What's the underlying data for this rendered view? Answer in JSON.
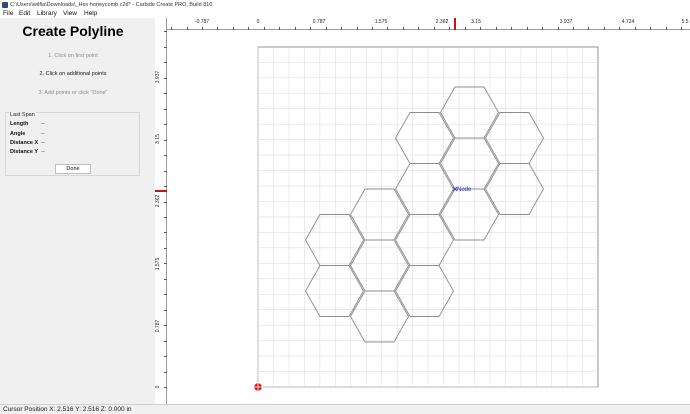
{
  "window": {
    "title": "C:\\Users\\wilfla\\Downloads\\_Hex honeycomb.c2d* - Carbide Create PRO, Build 816"
  },
  "menu": [
    "File",
    "Edit",
    "Library",
    "View",
    "Help"
  ],
  "panel": {
    "title": "Create Polyline",
    "steps": [
      {
        "label": "1. Click on first point",
        "state": "done"
      },
      {
        "label": "2. Click on additional points",
        "state": "active"
      },
      {
        "label": "3. Add points or click \"Done\"",
        "state": "pending"
      }
    ],
    "last_span": {
      "title": "Last Span",
      "rows": [
        {
          "label": "Length",
          "value": "--"
        },
        {
          "label": "Angle",
          "value": "--"
        },
        {
          "label": "Distance X",
          "value": "--"
        },
        {
          "label": "Distance Y",
          "value": "--"
        }
      ]
    },
    "done_label": "Done"
  },
  "rulers": {
    "top": [
      "-0.787",
      "0",
      "0.787",
      "1.575",
      "2.362",
      "3.15",
      "3.937",
      "4.724",
      "5.5"
    ],
    "left": [
      "3.937",
      "3.15",
      "2.362",
      "1.575",
      "0.787",
      "0"
    ]
  },
  "canvas": {
    "node_label": "Node",
    "colors": {
      "grid": "#dedede",
      "outline": "#8c8c8c",
      "node": "#1f2fd8",
      "cursor_marker": "#cc1111",
      "origin": "#dd1111"
    }
  },
  "status": "Cursor Position X: 2.516 Y: 2.516 Z: 0.000 in"
}
